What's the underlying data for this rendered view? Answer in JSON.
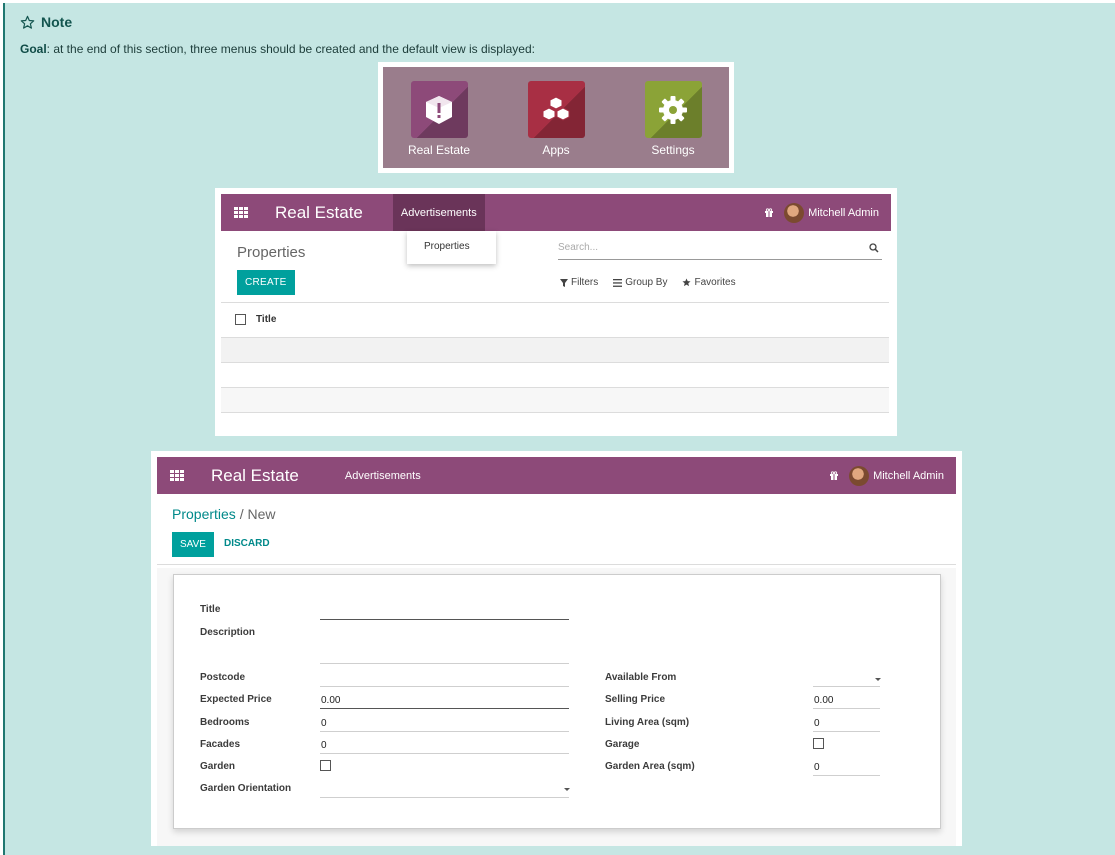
{
  "note": {
    "heading": "Note",
    "goal_label": "Goal",
    "goal_text": ": at the end of this section, three menus should be created and the default view is displayed:"
  },
  "apps": [
    {
      "label": "Real Estate",
      "icon": "warning-box-icon",
      "color": "#8d4a79"
    },
    {
      "label": "Apps",
      "icon": "cubes-icon",
      "color": "#a82f44"
    },
    {
      "label": "Settings",
      "icon": "gear-icon",
      "color": "#8ba337"
    }
  ],
  "list_view": {
    "brand": "Real Estate",
    "menu": "Advertisements",
    "dropdown_item": "Properties",
    "user": "Mitchell Admin",
    "title": "Properties",
    "create_label": "CREATE",
    "search_placeholder": "Search...",
    "filters": [
      "Filters",
      "Group By",
      "Favorites"
    ],
    "column_title": "Title"
  },
  "form_view": {
    "brand": "Real Estate",
    "menu": "Advertisements",
    "user": "Mitchell Admin",
    "breadcrumb_parent": "Properties",
    "breadcrumb_sep": " / ",
    "breadcrumb_current": "New",
    "save_label": "SAVE",
    "discard_label": "DISCARD",
    "fields": {
      "title": "Title",
      "description": "Description",
      "postcode": "Postcode",
      "expected_price": "Expected Price",
      "expected_price_value": "0.00",
      "bedrooms": "Bedrooms",
      "bedrooms_value": "0",
      "facades": "Facades",
      "facades_value": "0",
      "garden": "Garden",
      "garden_orientation": "Garden Orientation",
      "available_from": "Available From",
      "selling_price": "Selling Price",
      "selling_price_value": "0.00",
      "living_area": "Living Area (sqm)",
      "living_area_value": "0",
      "garage": "Garage",
      "garden_area": "Garden Area (sqm)",
      "garden_area_value": "0"
    }
  },
  "colors": {
    "note_bg": "#c5e6e3",
    "navbar": "#8d4a79",
    "primary": "#00a09d"
  }
}
